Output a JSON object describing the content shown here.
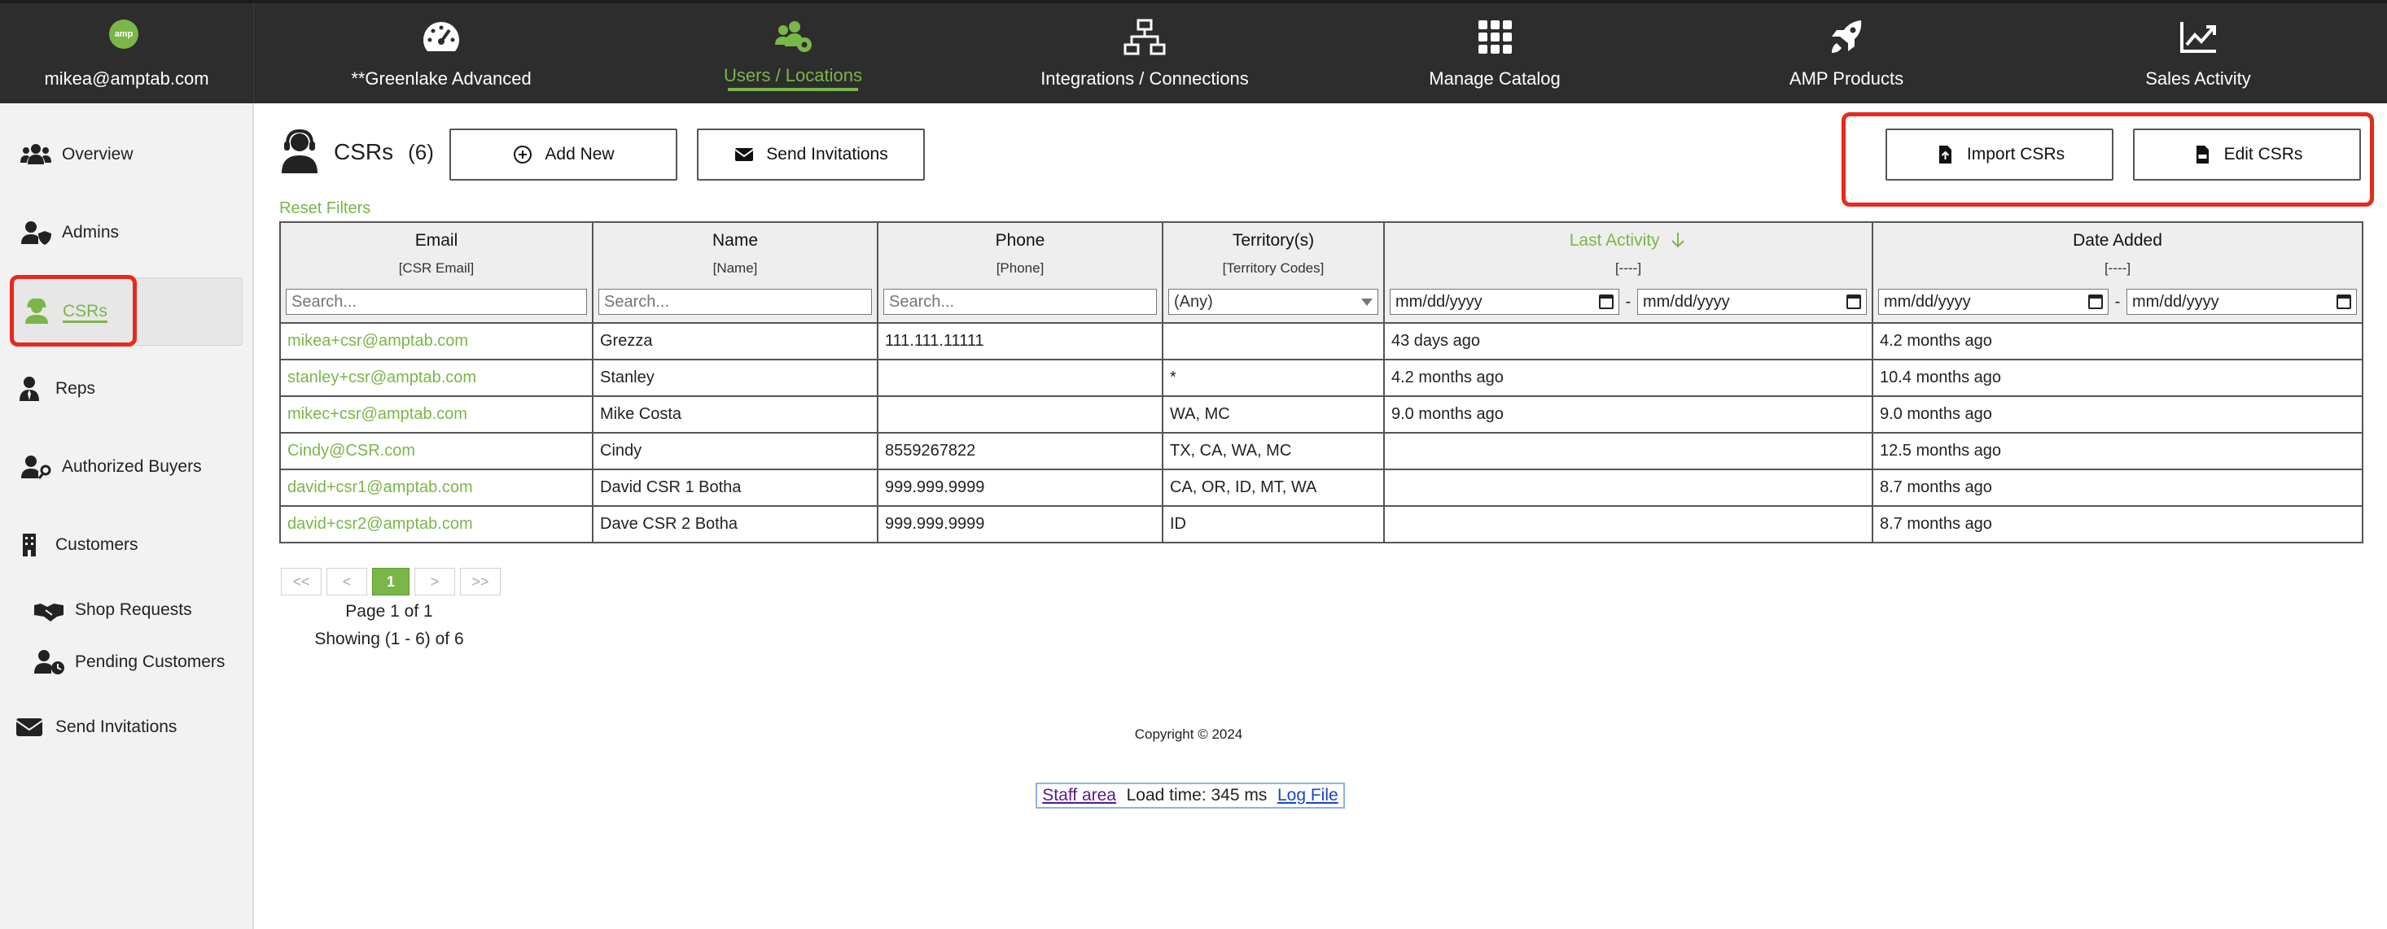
{
  "nav": {
    "user_email": "mikea@amptab.com",
    "logo_text": "amp",
    "items": [
      {
        "label": "**Greenlake Advanced",
        "icon": "speedometer-icon"
      },
      {
        "label": "Users / Locations",
        "icon": "users-gear-icon",
        "active": true
      },
      {
        "label": "Integrations / Connections",
        "icon": "network-icon"
      },
      {
        "label": "Manage Catalog",
        "icon": "grid-icon"
      },
      {
        "label": "AMP Products",
        "icon": "rocket-icon"
      },
      {
        "label": "Sales Activity",
        "icon": "chart-line-icon"
      }
    ],
    "active_color": "#7ab648"
  },
  "sidebar": {
    "items": [
      {
        "label": "Overview",
        "icon": "users-icon"
      },
      {
        "label": "Admins",
        "icon": "user-shield-icon"
      },
      {
        "label": "CSRs",
        "icon": "headset-user-icon",
        "active": true
      },
      {
        "label": "Reps",
        "icon": "user-tie-icon"
      },
      {
        "label": "Authorized Buyers",
        "icon": "user-key-icon"
      },
      {
        "label": "Customers",
        "icon": "building-icon"
      },
      {
        "label": "Shop Requests",
        "icon": "handshake-icon"
      },
      {
        "label": "Pending Customers",
        "icon": "user-clock-icon"
      },
      {
        "label": "Send Invitations",
        "icon": "envelope-icon"
      }
    ]
  },
  "page": {
    "title": "CSRs",
    "count": "(6)",
    "add_new": "Add New",
    "send_invitations": "Send Invitations",
    "import_csrs": "Import CSRs",
    "edit_csrs": "Edit CSRs",
    "reset_filters": "Reset Filters"
  },
  "table": {
    "columns": [
      {
        "title": "Email",
        "sub": "[CSR Email]",
        "filter_placeholder": "Search..."
      },
      {
        "title": "Name",
        "sub": "[Name]",
        "filter_placeholder": "Search..."
      },
      {
        "title": "Phone",
        "sub": "[Phone]",
        "filter_placeholder": "Search..."
      },
      {
        "title": "Territory(s)",
        "sub": "[Territory Codes]",
        "filter_value": "(Any)"
      },
      {
        "title": "Last Activity",
        "sub": "[----]",
        "sorted": "desc",
        "date_from": "mm/dd/yyyy",
        "date_to": "mm/dd/yyyy"
      },
      {
        "title": "Date Added",
        "sub": "[----]",
        "date_from": "mm/dd/yyyy",
        "date_to": "mm/dd/yyyy"
      }
    ],
    "date_separator": "-",
    "rows": [
      [
        "mikea+csr@amptab.com",
        "Grezza",
        "111.111.11111",
        "",
        "43 days ago",
        "4.2 months ago"
      ],
      [
        "stanley+csr@amptab.com",
        "Stanley",
        "",
        "*",
        "4.2 months ago",
        "10.4 months ago"
      ],
      [
        "mikec+csr@amptab.com",
        "Mike Costa",
        "",
        "WA, MC",
        "9.0 months ago",
        "9.0 months ago"
      ],
      [
        "Cindy@CSR.com",
        "Cindy",
        "8559267822",
        "TX, CA, WA, MC",
        "",
        "12.5 months ago"
      ],
      [
        "david+csr1@amptab.com",
        "David CSR 1 Botha",
        "999.999.9999",
        "CA, OR, ID, MT, WA",
        "",
        "8.7 months ago"
      ],
      [
        "david+csr2@amptab.com",
        "Dave CSR 2 Botha",
        "999.999.9999",
        "ID",
        "",
        "8.7 months ago"
      ]
    ]
  },
  "pagination": {
    "first": "<<",
    "prev": "<",
    "current": "1",
    "next": ">",
    "last": ">>",
    "page_text": "Page 1 of 1",
    "showing_text": "Showing (1 - 6) of 6"
  },
  "footer": {
    "copyright": "Copyright © 2024",
    "staff_area": "Staff area",
    "load_time": "Load time: 345 ms",
    "log_file": "Log File"
  },
  "colors": {
    "accent": "#7ab648",
    "topbar": "#2d2d2d",
    "highlight": "#e8291c"
  }
}
